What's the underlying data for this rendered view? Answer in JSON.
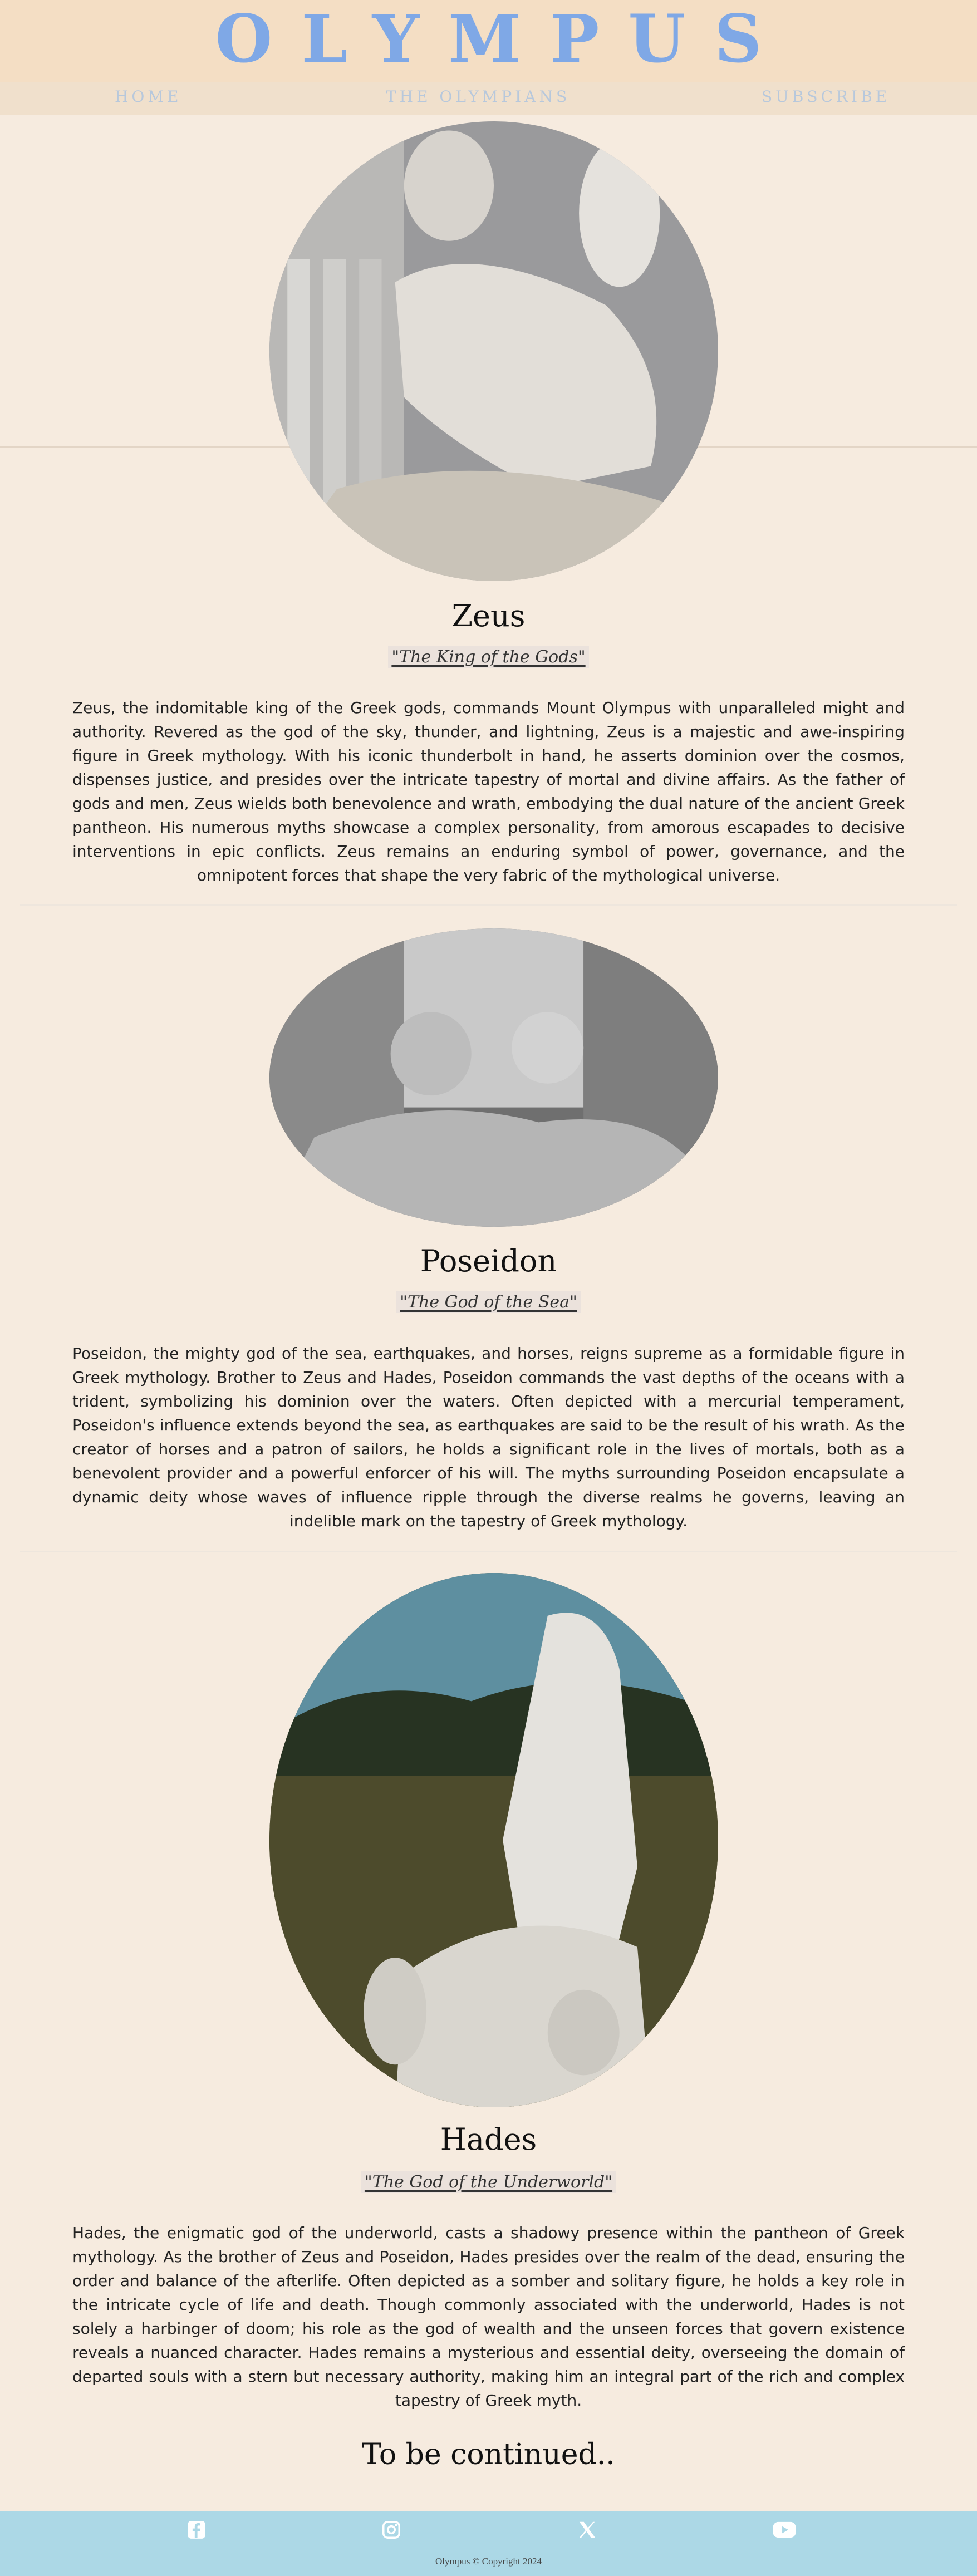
{
  "site": {
    "title": "OLYMPUS"
  },
  "nav": {
    "home": "HOME",
    "olympians": "THE OLYMPIANS",
    "subscribe": "SUBSCRIBE"
  },
  "gods": [
    {
      "name": "Zeus",
      "epithet": "\"The King of the Gods\"",
      "description": "Zeus, the indomitable king of the Greek gods, commands Mount Olympus with unparalleled might and authority. Revered as the god of the sky, thunder, and lightning, Zeus is a majestic and awe-inspiring figure in Greek mythology. With his iconic thunderbolt in hand, he asserts dominion over the cosmos, dispenses justice, and presides over the intricate tapestry of mortal and divine affairs. As the father of gods and men, Zeus wields both benevolence and wrath, embodying the dual nature of the ancient Greek pantheon. His numerous myths showcase a complex personality, from amorous escapades to decisive interventions in epic conflicts. Zeus remains an enduring symbol of power, governance, and the omnipotent forces that shape the very fabric of the mythological universe."
    },
    {
      "name": "Poseidon",
      "epithet": "\"The God of the Sea\"",
      "description": "Poseidon, the mighty god of the sea, earthquakes, and horses, reigns supreme as a formidable figure in Greek mythology. Brother to Zeus and Hades, Poseidon commands the vast depths of the oceans with a trident, symbolizing his dominion over the waters. Often depicted with a mercurial temperament, Poseidon's influence extends beyond the sea, as earthquakes are said to be the result of his wrath. As the creator of horses and a patron of sailors, he holds a significant role in the lives of mortals, both as a benevolent provider and a powerful enforcer of his will. The myths surrounding Poseidon encapsulate a dynamic deity whose waves of influence ripple through the diverse realms he governs, leaving an indelible mark on the tapestry of Greek mythology."
    },
    {
      "name": "Hades",
      "epithet": "\"The God of the Underworld\"",
      "description": "Hades, the enigmatic god of the underworld, casts a shadowy presence within the pantheon of Greek mythology. As the brother of Zeus and Poseidon, Hades presides over the realm of the dead, ensuring the order and balance of the afterlife. Often depicted as a somber and solitary figure, he holds a key role in the intricate cycle of life and death. Though commonly associated with the underworld, Hades is not solely a harbinger of doom; his role as the god of wealth and the unseen forces that govern existence reveals a nuanced character. Hades remains a mysterious and essential deity, overseeing the domain of departed souls with a stern but necessary authority, making him an integral part of the rich and complex tapestry of Greek myth."
    }
  ],
  "closing": {
    "text": "To be continued.."
  },
  "footer": {
    "icons": [
      "facebook-icon",
      "instagram-icon",
      "x-twitter-icon",
      "youtube-icon"
    ],
    "copyright": "Olympus © Copyright 2024"
  },
  "colors": {
    "background": "#f6ebdf",
    "header": "#f4dec4",
    "logo": "#7fa8e6",
    "footer": "#acd8e6"
  }
}
